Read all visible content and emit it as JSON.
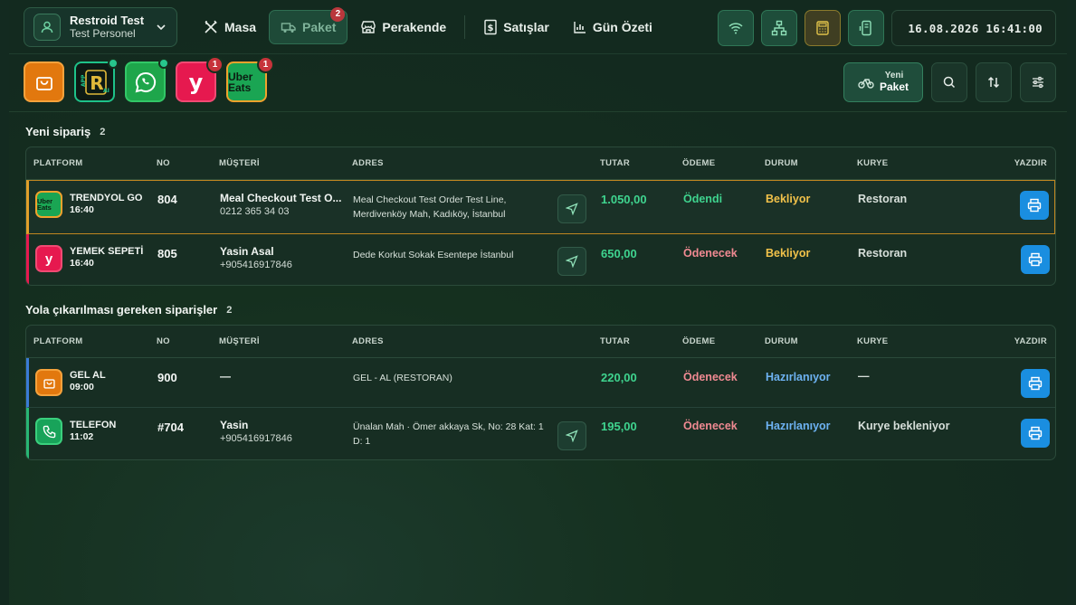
{
  "user": {
    "name": "Restroid Test",
    "role": "Test Personel"
  },
  "nav": [
    {
      "key": "masa",
      "label": "Masa"
    },
    {
      "key": "paket",
      "label": "Paket",
      "badge": "2"
    },
    {
      "key": "perakende",
      "label": "Perakende"
    },
    {
      "key": "satislar",
      "label": "Satışlar"
    },
    {
      "key": "gun_ozeti",
      "label": "Gün Özeti"
    }
  ],
  "datetime": "16.08.2026 16:41:00",
  "platforms": [
    {
      "key": "paket-app",
      "icon": "bag-icon"
    },
    {
      "key": "restroid-app",
      "icon": "restroid-app-icon",
      "logo": "R",
      "status": "online"
    },
    {
      "key": "whatsapp",
      "icon": "whatsapp-icon",
      "status": "online"
    },
    {
      "key": "yemeksepeti",
      "icon": "yemeksepeti-icon",
      "logo": "y",
      "badge": "1"
    },
    {
      "key": "ubereats",
      "icon": "ubereats-icon",
      "logo": "Uber Eats",
      "badge": "1"
    }
  ],
  "new_package": {
    "small": "Yeni",
    "big": "Paket"
  },
  "columns": {
    "platform": "PLATFORM",
    "no": "NO",
    "customer": "MÜŞTERİ",
    "address": "ADRES",
    "amount": "TUTAR",
    "payment": "ÖDEME",
    "status": "DURUM",
    "courier": "KURYE",
    "print": "YAZDIR"
  },
  "new_orders": {
    "title": "Yeni sipariş",
    "count": "2",
    "rows": [
      {
        "platform": "TRENDYOL GO",
        "time": "16:40",
        "icon": "ubereats-icon",
        "logo": "Uber Eats",
        "no": "804",
        "customer": "Meal Checkout Test O...",
        "phone": "0212 365 34 03",
        "address": "Meal Checkout Test Order Test Line, Merdivenköy Mah, Kadıköy, İstanbul",
        "amount": "1.050,00",
        "payment": "Ödendi",
        "status": "Bekliyor",
        "courier": "Restoran"
      },
      {
        "platform": "YEMEK SEPETİ",
        "time": "16:40",
        "icon": "yemeksepeti-icon",
        "logo": "y",
        "no": "805",
        "customer": "Yasin Asal",
        "phone": "+905416917846",
        "address": "Dede Korkut Sokak Esentepe İstanbul",
        "amount": "650,00",
        "payment": "Ödenecek",
        "status": "Bekliyor",
        "courier": "Restoran"
      }
    ]
  },
  "dispatch_orders": {
    "title": "Yola çıkarılması gereken siparişler",
    "count": "2",
    "rows": [
      {
        "platform": "GEL AL",
        "time": "09:00",
        "icon": "bag-icon",
        "no": "900",
        "customer": "—",
        "phone": "",
        "address": "GEL - AL (RESTORAN)",
        "amount": "220,00",
        "payment": "Ödenecek",
        "status": "Hazırlanıyor",
        "courier": "—"
      },
      {
        "platform": "TELEFON",
        "time": "11:02",
        "icon": "phone-icon",
        "no": "#704",
        "customer": "Yasin",
        "phone": "+905416917846",
        "address": "Ünalan Mah · Ömer akkaya Sk, No: 28 Kat: 1 D: 1",
        "amount": "195,00",
        "payment": "Ödenecek",
        "status": "Hazırlanıyor",
        "courier": "Kurye bekleniyor"
      }
    ]
  },
  "colors": {
    "accent": "#3fd48f",
    "warning": "#f2c24a",
    "danger": "#f08a92",
    "info": "#6db2f2",
    "print": "#1a8ee0"
  }
}
